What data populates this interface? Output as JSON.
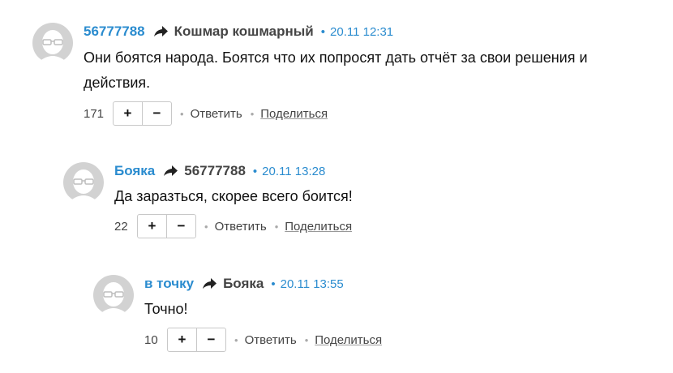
{
  "comments": [
    {
      "author": "56777788",
      "reply_to": "Кошмар кошмарный",
      "time": "20.11 12:31",
      "text": "Они боятся народа. Боятся что их попросят дать отчёт за свои решения и действия.",
      "score": "171",
      "reply_label": "Ответить",
      "share_label": "Поделиться"
    },
    {
      "author": "Бояка",
      "reply_to": "56777788",
      "time": "20.11 13:28",
      "text": "Да заразться,  скорее всего боится!",
      "score": "22",
      "reply_label": "Ответить",
      "share_label": "Поделиться"
    },
    {
      "author": "в точку",
      "reply_to": "Бояка",
      "time": "20.11 13:55",
      "text": "Точно!",
      "score": "10",
      "reply_label": "Ответить",
      "share_label": "Поделиться"
    }
  ],
  "vote": {
    "plus": "+",
    "minus": "−"
  },
  "separator": "•"
}
